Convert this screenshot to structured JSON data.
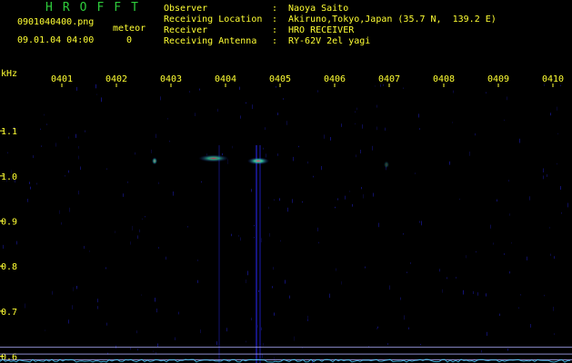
{
  "header": {
    "app_title": "HROFFT",
    "filename": "0901040400.png",
    "timestamp": "09.01.04 04:00",
    "meteor_label": "meteor",
    "meteor_count": "0",
    "observer_label": "Observer",
    "observer_value": "Naoya Saito",
    "location_label": "Receiving Location",
    "location_value": "Akiruno,Tokyo,Japan (35.7 N,  139.2 E)",
    "receiver_label": "Receiver",
    "receiver_value": "HRO RECEIVER",
    "antenna_label": "Receiving Antenna",
    "antenna_value": "RY-62V 2el yagi",
    "colon": ":"
  },
  "colors": {
    "title_green": "#2ecc3b",
    "text_yellow": "#ffff33",
    "noise_blue": "#1a1aa0",
    "echo_core": "#ff3366",
    "echo_halo": "#33ddaa"
  },
  "chart_data": {
    "type": "heatmap",
    "ylabel": "kHz",
    "x_ticks": [
      "0401",
      "0402",
      "0403",
      "0404",
      "0405",
      "0406",
      "0407",
      "0408",
      "0409",
      "0410"
    ],
    "y_ticks": [
      "1.1",
      "1.0",
      "0.9",
      "0.8",
      "0.7",
      "0.6"
    ],
    "y_tick_values": [
      1.1,
      1.0,
      0.9,
      0.8,
      0.7,
      0.6
    ],
    "ylim": [
      0.585,
      1.205
    ],
    "xlim_minutes": [
      0.4,
      10.2
    ],
    "echoes": [
      {
        "t_min": 1.7,
        "f_khz": 1.033,
        "duration_min": 0.1,
        "intensity": 0.9
      },
      {
        "t_min": 2.78,
        "f_khz": 1.039,
        "duration_min": 0.55,
        "intensity": 0.8
      },
      {
        "t_min": 3.6,
        "f_khz": 1.033,
        "duration_min": 0.4,
        "intensity": 1.0
      },
      {
        "t_min": 5.95,
        "f_khz": 1.025,
        "duration_min": 0.05,
        "intensity": 0.4
      }
    ],
    "reference_lines_khz": [
      0.62,
      0.605,
      0.592
    ]
  }
}
